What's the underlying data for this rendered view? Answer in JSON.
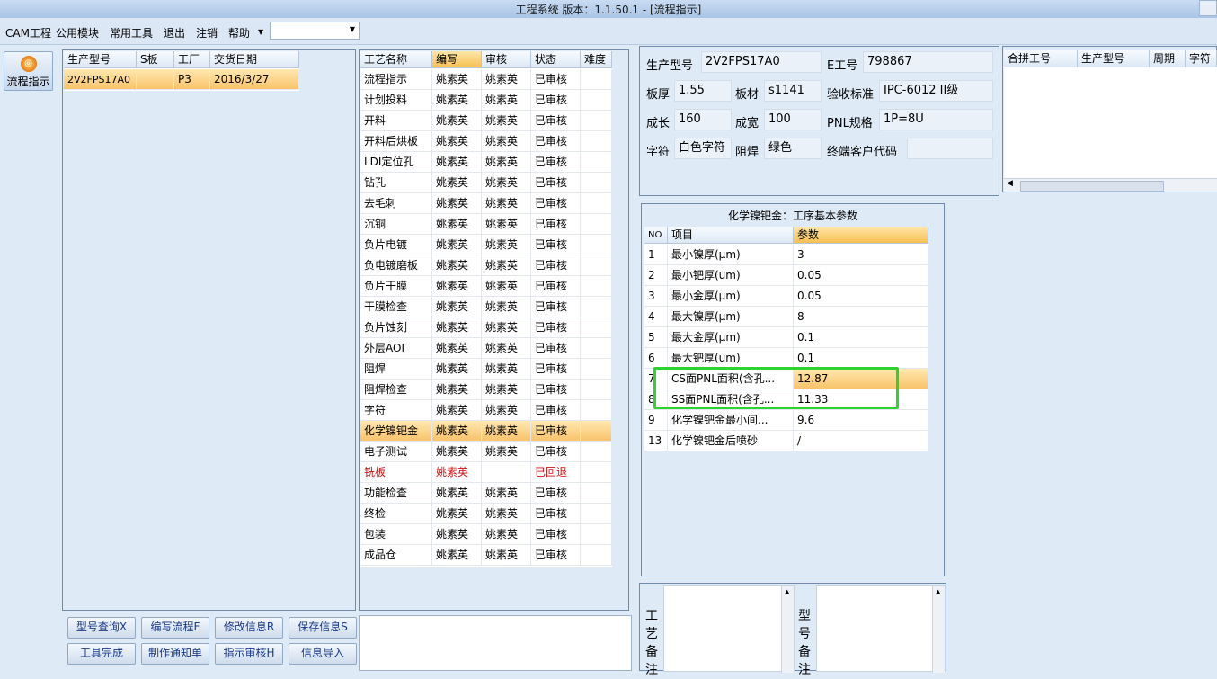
{
  "window": {
    "title": "工程系统   版本：1.1.50.1 - [流程指示]"
  },
  "menu": {
    "items": [
      "CAM工程",
      "公用模块",
      "常用工具",
      "退出",
      "注销",
      "帮助"
    ],
    "dropdown_value": ""
  },
  "toolbar": {
    "flow_button": "流程指示"
  },
  "orders": {
    "headers": [
      "生产型号",
      "S板",
      "工厂",
      "交货日期"
    ],
    "rows": [
      {
        "model": "2V2FPS17A0",
        "s": "",
        "factory": "P3",
        "date": "2016/3/27"
      }
    ]
  },
  "process": {
    "headers": [
      "工艺名称",
      "编写",
      "审核",
      "状态",
      "难度"
    ],
    "rows": [
      {
        "name": "流程指示",
        "writer": "姚素英",
        "reviewer": "姚素英",
        "status": "已审核",
        "difficulty": ""
      },
      {
        "name": "计划投料",
        "writer": "姚素英",
        "reviewer": "姚素英",
        "status": "已审核",
        "difficulty": ""
      },
      {
        "name": "开料",
        "writer": "姚素英",
        "reviewer": "姚素英",
        "status": "已审核",
        "difficulty": ""
      },
      {
        "name": "开料后烘板",
        "writer": "姚素英",
        "reviewer": "姚素英",
        "status": "已审核",
        "difficulty": ""
      },
      {
        "name": "LDI定位孔",
        "writer": "姚素英",
        "reviewer": "姚素英",
        "status": "已审核",
        "difficulty": ""
      },
      {
        "name": "钻孔",
        "writer": "姚素英",
        "reviewer": "姚素英",
        "status": "已审核",
        "difficulty": ""
      },
      {
        "name": "去毛刺",
        "writer": "姚素英",
        "reviewer": "姚素英",
        "status": "已审核",
        "difficulty": ""
      },
      {
        "name": "沉铜",
        "writer": "姚素英",
        "reviewer": "姚素英",
        "status": "已审核",
        "difficulty": ""
      },
      {
        "name": "负片电镀",
        "writer": "姚素英",
        "reviewer": "姚素英",
        "status": "已审核",
        "difficulty": ""
      },
      {
        "name": "负电镀磨板",
        "writer": "姚素英",
        "reviewer": "姚素英",
        "status": "已审核",
        "difficulty": ""
      },
      {
        "name": "负片干膜",
        "writer": "姚素英",
        "reviewer": "姚素英",
        "status": "已审核",
        "difficulty": ""
      },
      {
        "name": "干膜检查",
        "writer": "姚素英",
        "reviewer": "姚素英",
        "status": "已审核",
        "difficulty": ""
      },
      {
        "name": "负片蚀刻",
        "writer": "姚素英",
        "reviewer": "姚素英",
        "status": "已审核",
        "difficulty": ""
      },
      {
        "name": "外层AOI",
        "writer": "姚素英",
        "reviewer": "姚素英",
        "status": "已审核",
        "difficulty": ""
      },
      {
        "name": "阻焊",
        "writer": "姚素英",
        "reviewer": "姚素英",
        "status": "已审核",
        "difficulty": ""
      },
      {
        "name": "阻焊检查",
        "writer": "姚素英",
        "reviewer": "姚素英",
        "status": "已审核",
        "difficulty": ""
      },
      {
        "name": "字符",
        "writer": "姚素英",
        "reviewer": "姚素英",
        "status": "已审核",
        "difficulty": ""
      },
      {
        "name": "化学镍钯金",
        "writer": "姚素英",
        "reviewer": "姚素英",
        "status": "已审核",
        "difficulty": ""
      },
      {
        "name": "电子测试",
        "writer": "姚素英",
        "reviewer": "姚素英",
        "status": "已审核",
        "difficulty": ""
      },
      {
        "name": "铣板",
        "writer": "姚素英",
        "reviewer": "",
        "status": "已回退",
        "difficulty": ""
      },
      {
        "name": "功能检查",
        "writer": "姚素英",
        "reviewer": "姚素英",
        "status": "已审核",
        "difficulty": ""
      },
      {
        "name": "终检",
        "writer": "姚素英",
        "reviewer": "姚素英",
        "status": "已审核",
        "difficulty": ""
      },
      {
        "name": "包装",
        "writer": "姚素英",
        "reviewer": "姚素英",
        "status": "已审核",
        "difficulty": ""
      },
      {
        "name": "成品仓",
        "writer": "姚素英",
        "reviewer": "姚素英",
        "status": "已审核",
        "difficulty": ""
      }
    ]
  },
  "info": {
    "model_label": "生产型号",
    "model": "2V2FPS17A0",
    "eno_label": "E工号",
    "eno": "798867",
    "thickness_label": "板厚",
    "thickness": "1.55",
    "material_label": "板材",
    "material": "s1141",
    "standard_label": "验收标准",
    "standard": "IPC-6012 II级",
    "length_label": "成长",
    "length": "160",
    "width_label": "成宽",
    "width": "100",
    "pnl_label": "PNL规格",
    "pnl": "1P=8U",
    "char_label": "字符",
    "char": "白色字符",
    "mask_label": "阻焊",
    "mask": "绿色",
    "customer_label": "终端客户代码",
    "customer": ""
  },
  "combine": {
    "headers": [
      "合拼工号",
      "生产型号",
      "周期",
      "字符"
    ]
  },
  "params": {
    "title": "化学镍钯金：工序基本参数",
    "headers": [
      "NO",
      "项目",
      "参数"
    ],
    "rows": [
      {
        "no": "1",
        "item": "最小镍厚(μm)",
        "value": "3"
      },
      {
        "no": "2",
        "item": "最小钯厚(um)",
        "value": "0.05"
      },
      {
        "no": "3",
        "item": "最小金厚(μm)",
        "value": "0.05"
      },
      {
        "no": "4",
        "item": "最大镍厚(μm)",
        "value": "8"
      },
      {
        "no": "5",
        "item": "最大金厚(μm)",
        "value": "0.1"
      },
      {
        "no": "6",
        "item": "最大钯厚(um)",
        "value": "0.1"
      },
      {
        "no": "7",
        "item": "CS面PNL面积(含孔...",
        "value": "12.87"
      },
      {
        "no": "8",
        "item": "SS面PNL面积(含孔...",
        "value": "11.33"
      },
      {
        "no": "9",
        "item": "化学镍钯金最小间...",
        "value": "9.6"
      },
      {
        "no": "13",
        "item": "化学镍钯金后喷砂",
        "value": "/"
      }
    ]
  },
  "remarks": {
    "process_label": "工艺备注",
    "model_label": "型号备注"
  },
  "buttons": {
    "query": "型号查询X",
    "write": "编写流程F",
    "modify": "修改信息R",
    "save": "保存信息S",
    "finish": "工具完成",
    "notice": "制作通知单",
    "review": "指示审核H",
    "import": "信息导入"
  },
  "colors": {
    "highlight_border": "#2fd32f",
    "selection": "#f9c36a"
  }
}
